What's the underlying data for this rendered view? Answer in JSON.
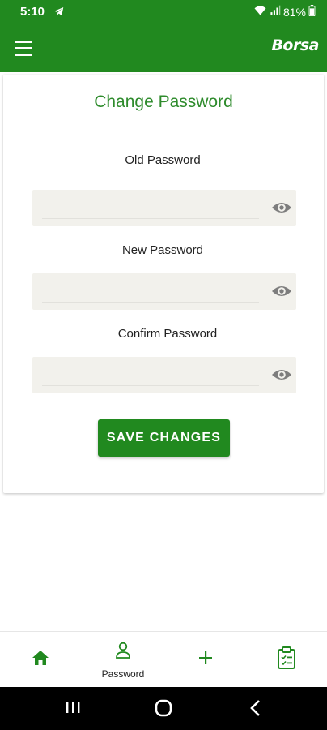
{
  "status": {
    "time": "5:10",
    "battery": "81%"
  },
  "app_bar": {
    "brand": "Borsa"
  },
  "form": {
    "title": "Change Password",
    "fields": [
      {
        "label": "Old Password",
        "value": ""
      },
      {
        "label": "New Password",
        "value": ""
      },
      {
        "label": "Confirm Password",
        "value": ""
      }
    ],
    "save_label": "SAVE CHANGES"
  },
  "bottom_nav": {
    "items": [
      {
        "icon": "home-icon",
        "label": ""
      },
      {
        "icon": "person-icon",
        "label": "Password"
      },
      {
        "icon": "plus-icon",
        "label": ""
      },
      {
        "icon": "clipboard-icon",
        "label": ""
      }
    ]
  },
  "colors": {
    "primary": "#21891f",
    "title": "#2e8b2c",
    "field_bg": "#f2f1ec",
    "eye_icon": "#7d7d7d"
  }
}
